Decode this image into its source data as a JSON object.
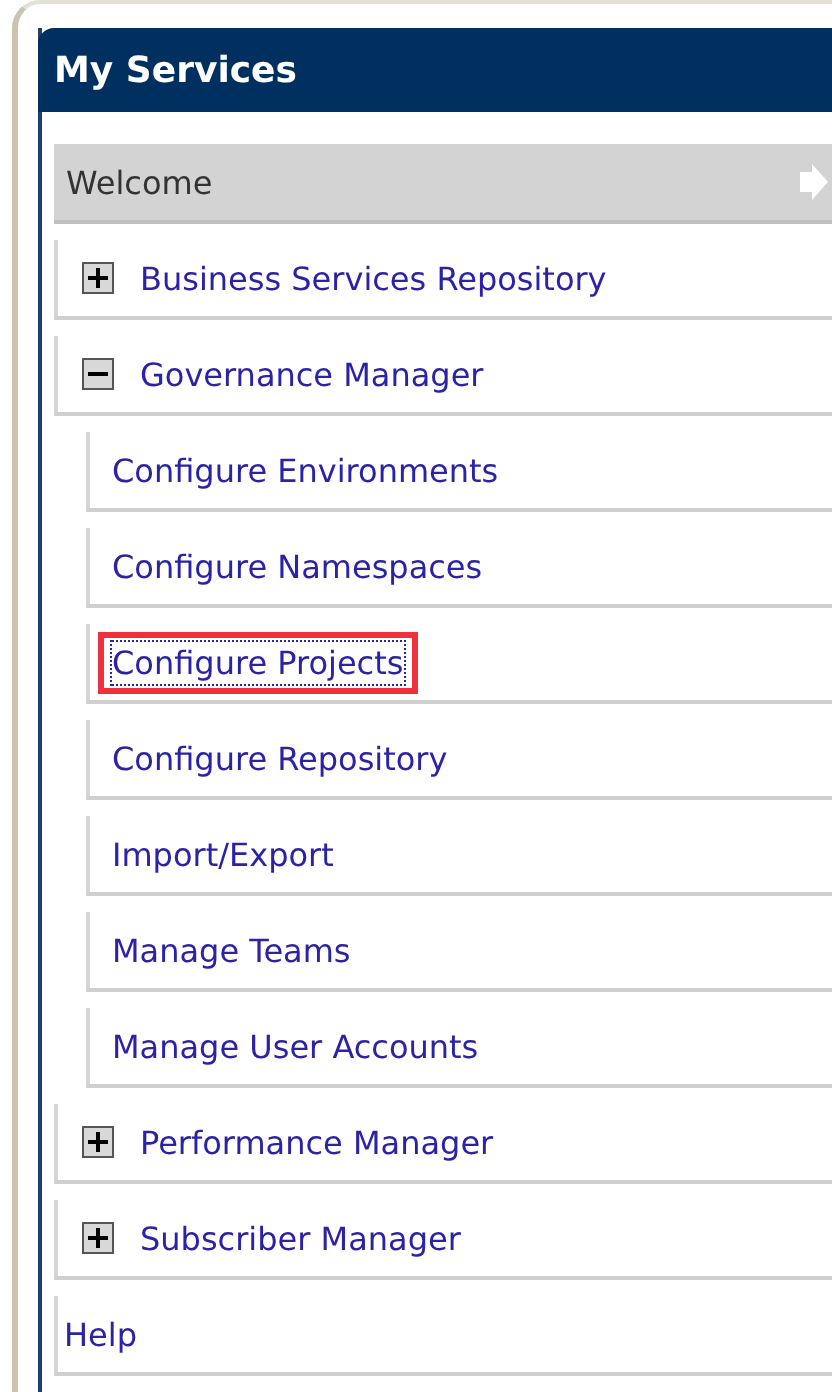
{
  "panel": {
    "title": "My Services"
  },
  "items": [
    {
      "kind": "current",
      "label": "Welcome"
    },
    {
      "kind": "group",
      "label": "Business Services Repository",
      "expanded": false
    },
    {
      "kind": "group",
      "label": "Governance Manager",
      "expanded": true,
      "children": [
        {
          "label": "Configure Environments",
          "focused": false,
          "highlighted": false
        },
        {
          "label": "Configure Namespaces",
          "focused": false,
          "highlighted": false
        },
        {
          "label": "Configure Projects",
          "focused": true,
          "highlighted": true
        },
        {
          "label": "Configure Repository",
          "focused": false,
          "highlighted": false
        },
        {
          "label": "Import/Export",
          "focused": false,
          "highlighted": false
        },
        {
          "label": "Manage Teams",
          "focused": false,
          "highlighted": false
        },
        {
          "label": "Manage User Accounts",
          "focused": false,
          "highlighted": false
        }
      ]
    },
    {
      "kind": "group",
      "label": "Performance Manager",
      "expanded": false
    },
    {
      "kind": "group",
      "label": "Subscriber Manager",
      "expanded": false
    },
    {
      "kind": "link",
      "label": "Help"
    }
  ]
}
